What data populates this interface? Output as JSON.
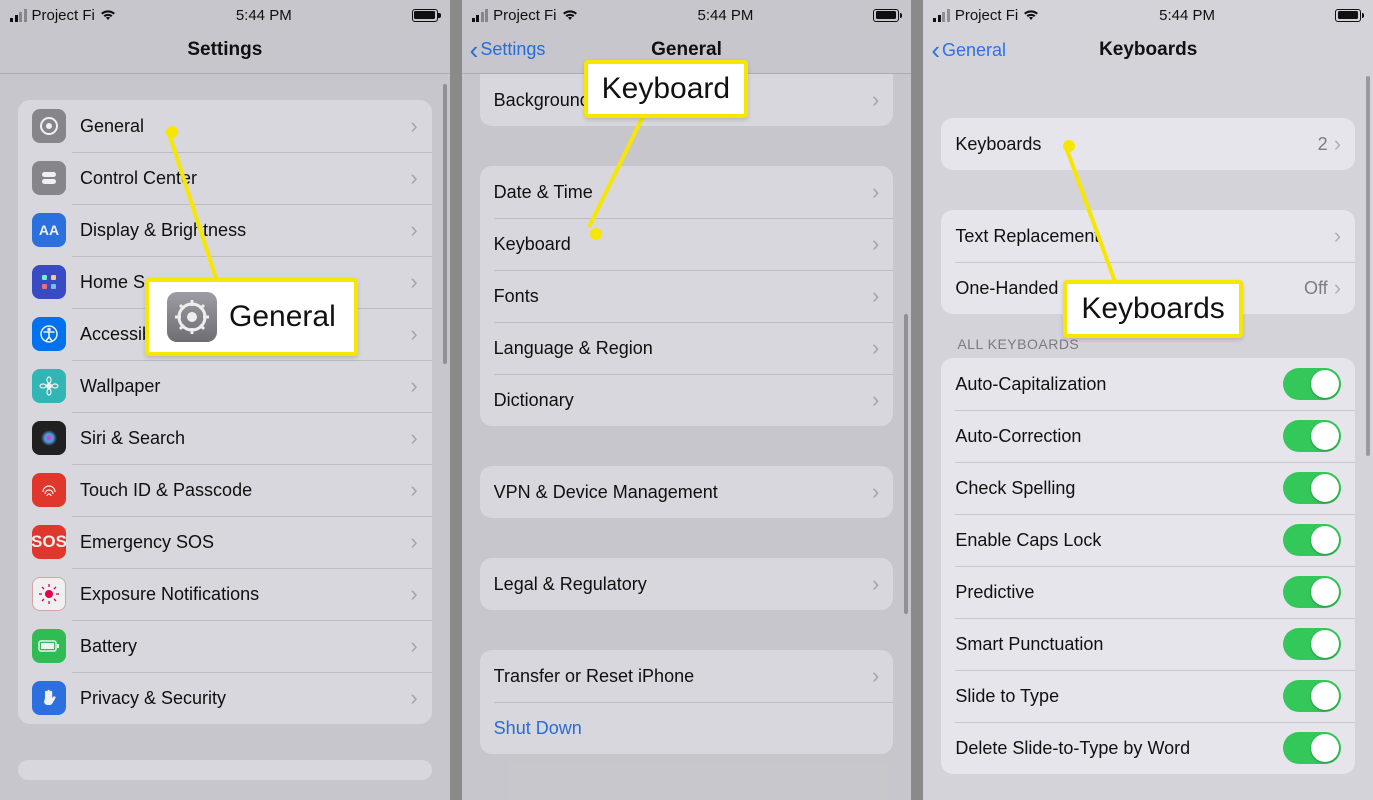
{
  "status": {
    "carrier": "Project Fi",
    "time": "5:44 PM"
  },
  "pane1": {
    "title": "Settings",
    "rows": [
      "General",
      "Control Center",
      "Display & Brightness",
      "Home Screen",
      "Accessibility",
      "Wallpaper",
      "Siri & Search",
      "Touch ID & Passcode",
      "Emergency SOS",
      "Exposure Notifications",
      "Battery",
      "Privacy & Security"
    ],
    "callout": "General"
  },
  "pane2": {
    "back": "Settings",
    "title": "General",
    "topRow": "Background App Refresh",
    "group1": [
      "Date & Time",
      "Keyboard",
      "Fonts",
      "Language & Region",
      "Dictionary"
    ],
    "group2": [
      "VPN & Device Management"
    ],
    "group3": [
      "Legal & Regulatory"
    ],
    "group4": [
      "Transfer or Reset iPhone",
      "Shut Down"
    ],
    "callout": "Keyboard"
  },
  "pane3": {
    "back": "General",
    "title": "Keyboards",
    "group1": {
      "label": "Keyboards",
      "count": "2"
    },
    "group2": [
      {
        "label": "Text Replacement"
      },
      {
        "label": "One-Handed Keyboard",
        "detail": "Off"
      }
    ],
    "sectionHeader": "ALL KEYBOARDS",
    "toggles": [
      "Auto-Capitalization",
      "Auto-Correction",
      "Check Spelling",
      "Enable Caps Lock",
      "Predictive",
      "Smart Punctuation",
      "Slide to Type",
      "Delete Slide-to-Type by Word"
    ],
    "callout": "Keyboards"
  }
}
